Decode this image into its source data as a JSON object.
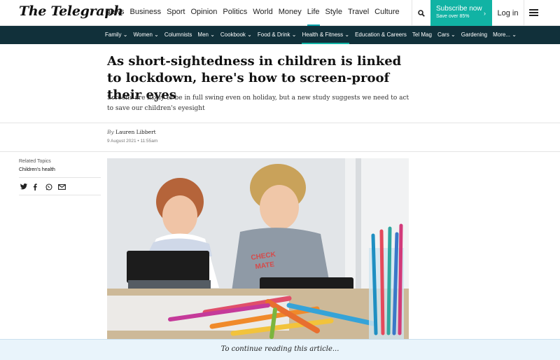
{
  "header": {
    "logo": "The Telegraph",
    "nav": [
      "News",
      "Business",
      "Sport",
      "Opinion",
      "Politics",
      "World",
      "Money",
      "Life",
      "Style",
      "Travel",
      "Culture"
    ],
    "active_nav": "Life",
    "subscribe_label": "Subscribe now",
    "subscribe_sub": "Save over 85%",
    "login_label": "Log in"
  },
  "subnav": {
    "items": [
      "Family ⌄",
      "Women ⌄",
      "Columnists",
      "Men ⌄",
      "Cookbook ⌄",
      "Food & Drink ⌄",
      "Health & Fitness ⌄",
      "Education & Careers",
      "Tel Mag",
      "Cars ⌄",
      "Gardening",
      "More... ⌄"
    ],
    "active": "Health & Fitness ⌄"
  },
  "article": {
    "headline": "As short-sightedness in children is linked to lockdown, here's how to screen-proof their eyes",
    "standfirst": "Screens are likely to be in full swing even on holiday, but a new study suggests we need to act to save our children's eyesight",
    "byline_prefix": "By",
    "author": "Lauren Libbert",
    "date": "9 August 2021 • 11:55am"
  },
  "sidebar": {
    "related_label": "Related Topics",
    "related_topic": "Children's health",
    "share_icons": [
      "twitter-icon",
      "facebook-icon",
      "whatsapp-icon",
      "email-icon"
    ]
  },
  "hero": {
    "tshirt_text_1": "CHECK",
    "tshirt_text_2": "MATE"
  },
  "paywall": {
    "text": "To continue reading this article..."
  },
  "colors": {
    "accent": "#11b3a4",
    "subnav_bg": "#11303a",
    "paywall_bg": "#e9f4fb"
  }
}
